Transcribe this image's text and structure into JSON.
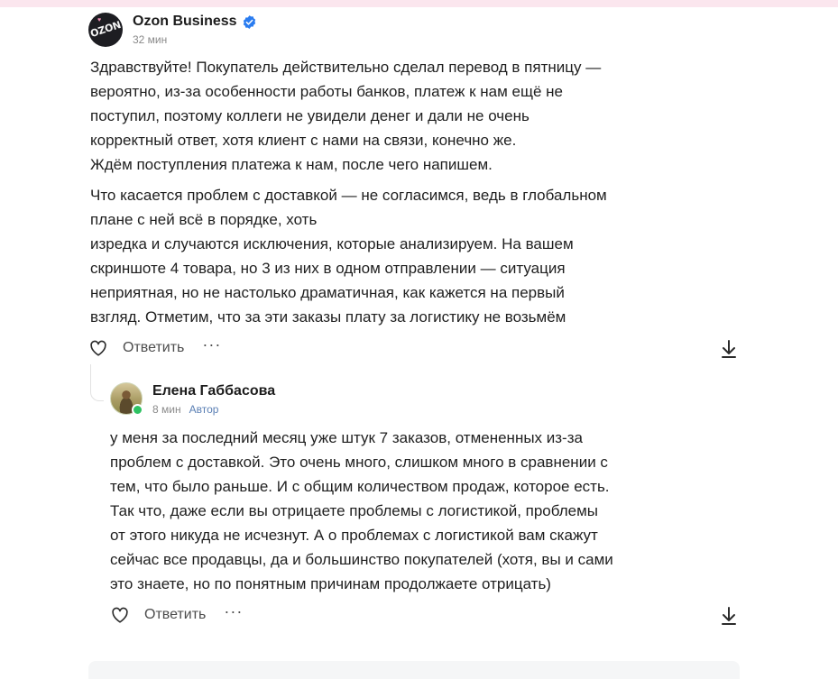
{
  "comments": [
    {
      "author": "Ozon Business",
      "verified": true,
      "time": "32 мин",
      "avatar_icon": "ozon-logo-avatar",
      "avatar_text": "OZON",
      "paragraphs": [
        "Здравствуйте! Покупатель действительно сделал перевод в пятницу —\nвероятно, из-за особенности работы банков, платеж к нам ещё не\nпоступил, поэтому коллеги не увидели денег и дали не очень\nкорректный ответ, хотя клиент с нами на связи, конечно же.\nЖдём поступления платежа к нам, после чего напишем.",
        "Что касается проблем с доставкой — не согласимся, ведь в глобальном\nплане с ней всё в порядке, хоть\nизредка и случаются исключения, которые анализируем. На вашем\nскриншоте 4 товара, но 3 из них в одном отправлении — ситуация\nнеприятная, но не настолько драматичная, как кажется на первый\nвзгляд. Отметим, что за эти заказы плату за логистику не возьмём"
      ],
      "reply_label": "Ответить",
      "more_label": "···"
    },
    {
      "author": "Елена Габбасова",
      "time": "8 мин",
      "badge": "Автор",
      "online": true,
      "avatar_icon": "user-photo-avatar",
      "paragraphs": [
        "у меня за последний месяц уже штук 7 заказов, отмененных из-за\nпроблем с доставкой. Это очень много, слишком много в сравнении с\nтем, что было раньше. И с общим количеством продаж, которое есть.\nТак что, даже если вы отрицаете проблемы с логистикой, проблемы\nот этого никуда не исчезнут. А о проблемах с логистикой вам скажут\nсейчас все продавцы, да и большинство покупателей (хотя, вы и сами\nэто знаете, но по понятным причинам продолжаете отрицать)"
      ],
      "reply_label": "Ответить",
      "more_label": "···"
    }
  ],
  "colors": {
    "verified_badge": "#2a7cf0",
    "author_badge": "#5a7fb4",
    "online": "#2ec262",
    "top_strip": "#fbe6ee"
  }
}
